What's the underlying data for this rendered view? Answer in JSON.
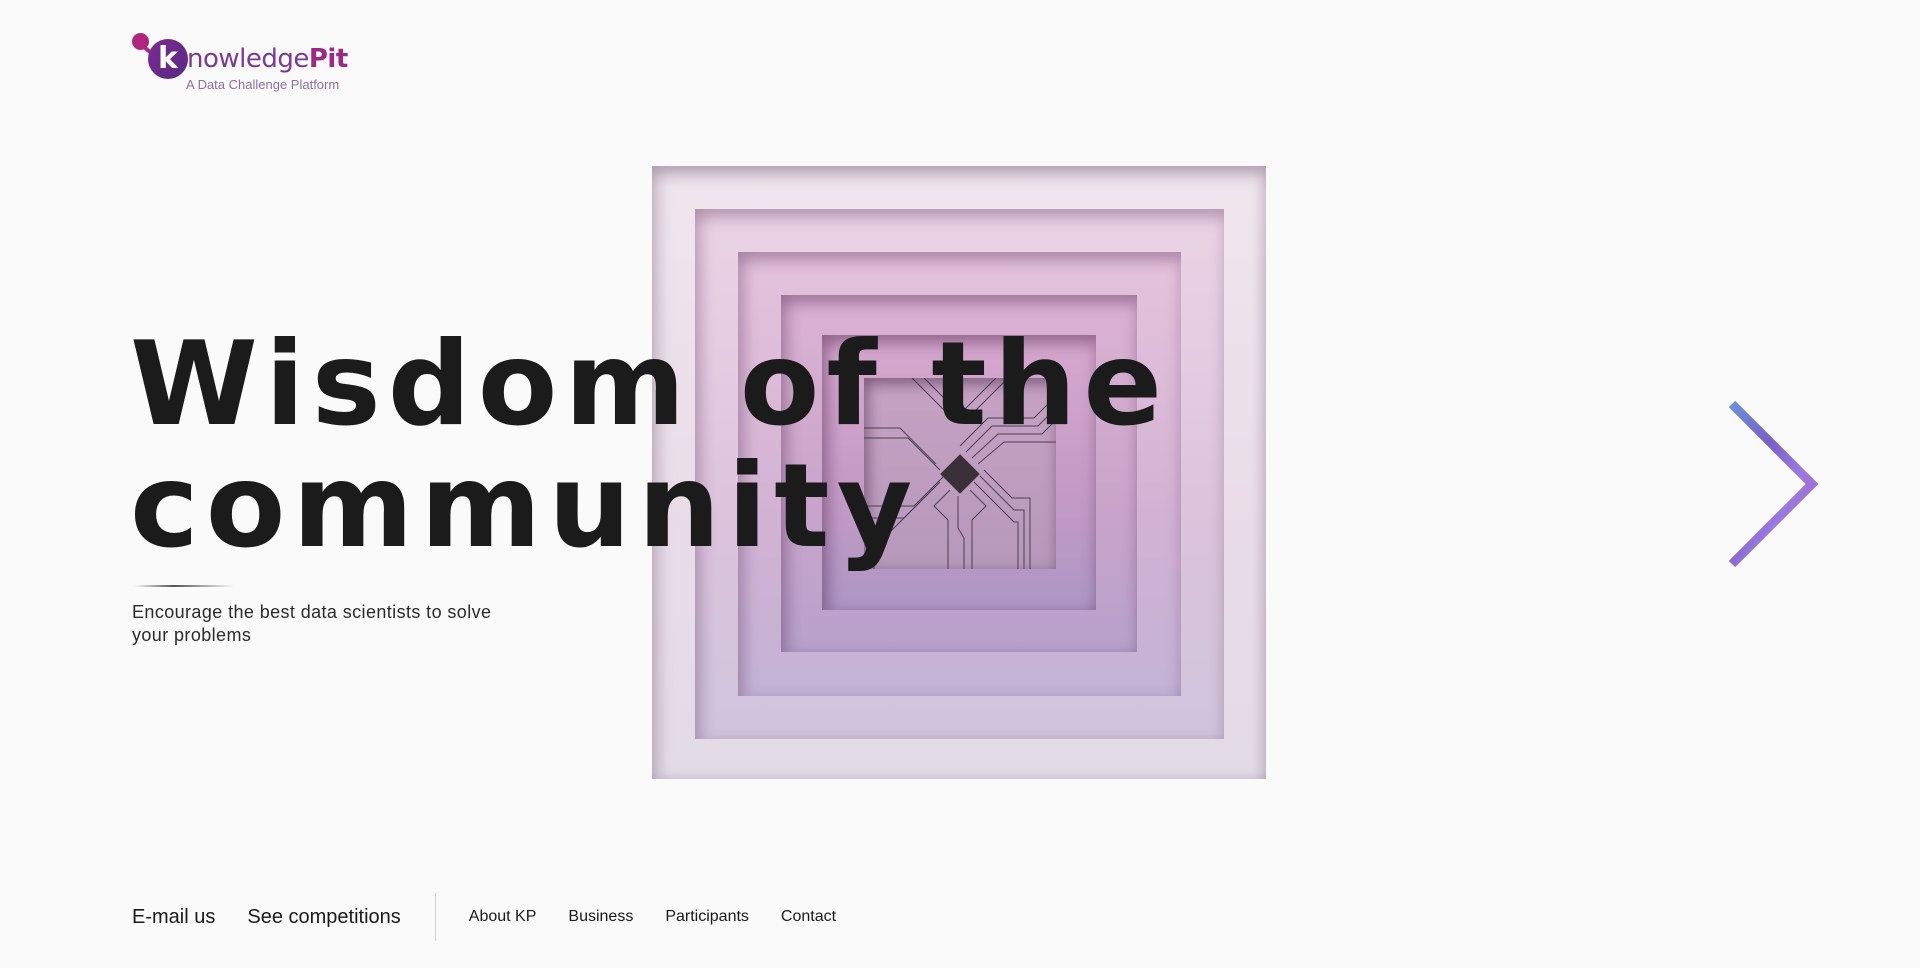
{
  "logo": {
    "initial": "k",
    "word_part1": "nowledge",
    "word_part2": "Pit",
    "tagline": "A Data Challenge Platform"
  },
  "hero": {
    "headline_line1": "Wisdom of the",
    "headline_line2": "community",
    "subtitle_line1": "Encourage the best data scientists to solve",
    "subtitle_line2": "your problems"
  },
  "navigation": {
    "primary": [
      "E-mail us",
      "See competitions"
    ],
    "secondary": [
      "About KP",
      "Business",
      "Participants",
      "Contact"
    ]
  },
  "icons": {
    "next": "chevron-right-icon"
  },
  "colors": {
    "brand_purple": "#7b3a96",
    "brand_magenta": "#b0267e",
    "text": "#1a1a1a",
    "background": "#fafafa"
  }
}
